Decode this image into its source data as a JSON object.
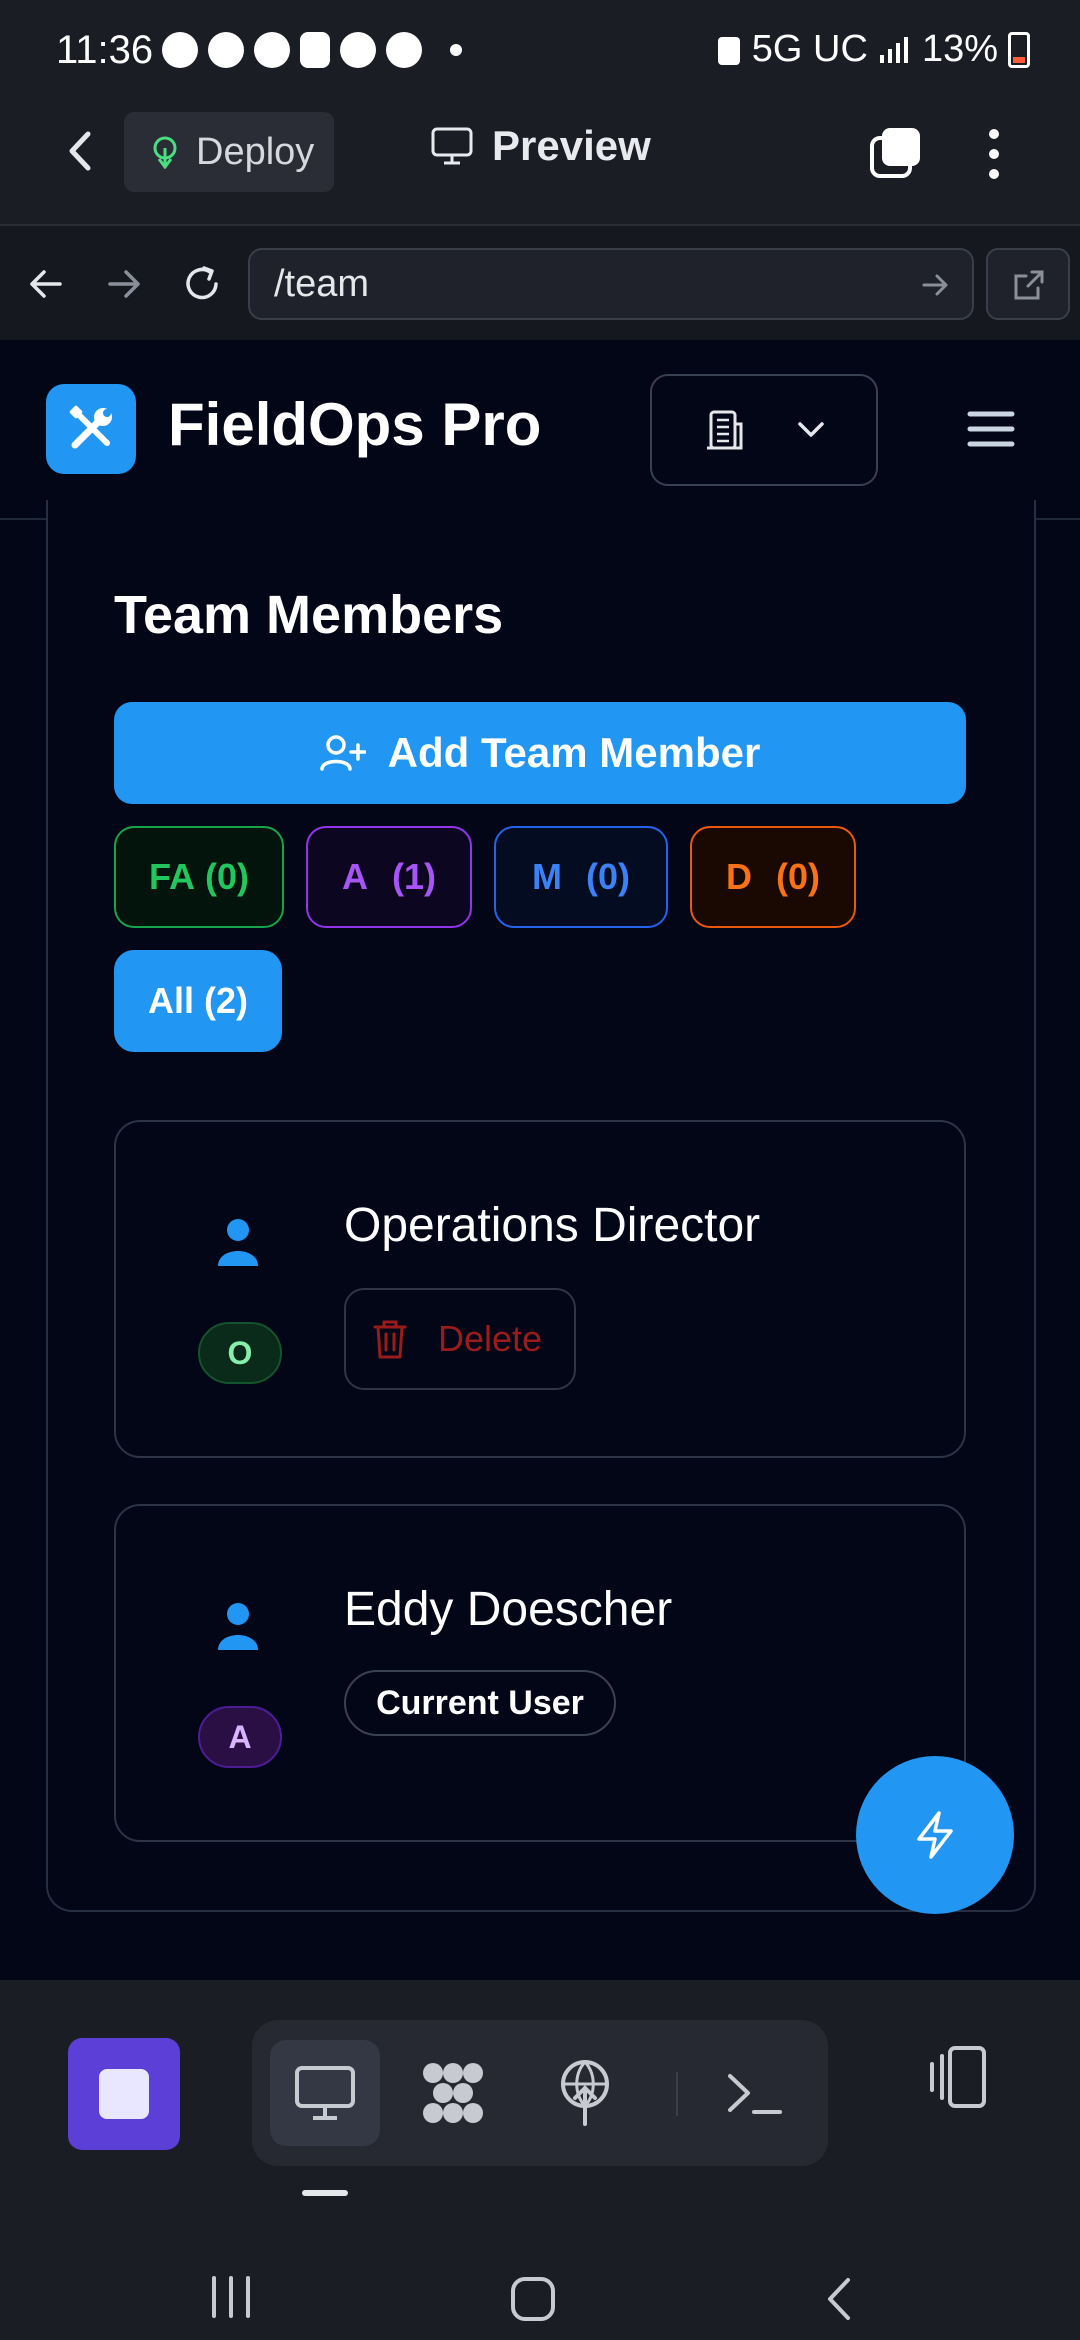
{
  "status_bar": {
    "time": "11:36",
    "network": "5G UC",
    "battery": "13%"
  },
  "toolbar": {
    "deploy_label": "Deploy",
    "preview_label": "Preview"
  },
  "url_bar": {
    "url": "/team"
  },
  "app": {
    "brand": "FieldOps Pro"
  },
  "team": {
    "title": "Team Members",
    "add_button": "Add Team Member",
    "filters": [
      {
        "label": "FA",
        "count": "(0)",
        "color": "#22c55e"
      },
      {
        "label": "A",
        "count": "(1)",
        "color": "#a855f7"
      },
      {
        "label": "M",
        "count": "(0)",
        "color": "#3b82f6"
      },
      {
        "label": "D",
        "count": "(0)",
        "color": "#f97316"
      },
      {
        "label": "All (2)",
        "selected": true,
        "color": "#2196f3"
      }
    ],
    "members": [
      {
        "name": "Operations Director",
        "role_initial": "O",
        "action_label": "Delete"
      },
      {
        "name": "Eddy Doescher",
        "role_initial": "A",
        "tag": "Current User"
      }
    ]
  },
  "colors": {
    "accent": "#2196f3",
    "background": "#020617",
    "stop_button": "#5b3fd6",
    "delete_red": "#991b1b"
  },
  "icons": {
    "logo": "wrench-screwdriver-icon",
    "org_selector": "building-icon",
    "fab": "lightning-icon"
  }
}
